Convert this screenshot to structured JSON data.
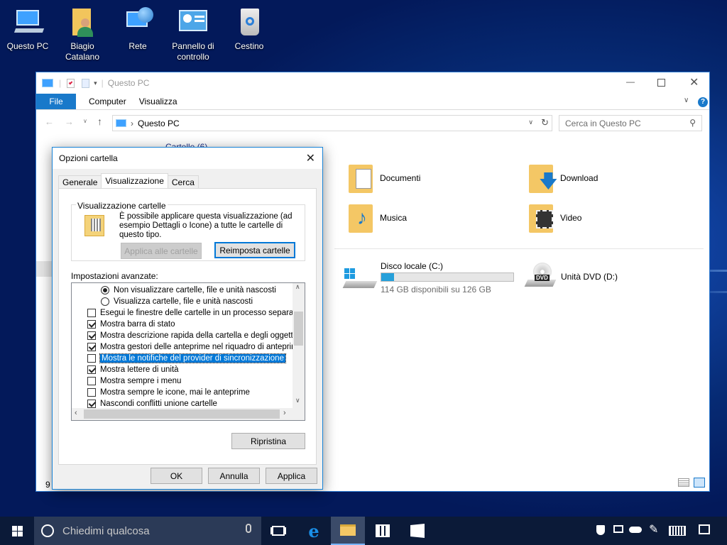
{
  "desktop": {
    "icons": [
      {
        "label": "Questo PC"
      },
      {
        "label": "Biagio Catalano"
      },
      {
        "label": "Rete"
      },
      {
        "label": "Pannello di controllo"
      },
      {
        "label": "Cestino"
      }
    ]
  },
  "explorer": {
    "title": "Questo PC",
    "ribbon_tabs": [
      "File",
      "Computer",
      "Visualizza"
    ],
    "address": "Questo PC",
    "search_placeholder": "Cerca in Questo PC",
    "section_partial": "Cartelle (6)",
    "folders": [
      "Documenti",
      "Download",
      "Musica",
      "Video"
    ],
    "drives": [
      {
        "name": "Disco locale (C:)",
        "free_text": "114 GB disponibili su 126 GB",
        "used_fraction": 0.095
      },
      {
        "name": "Unità DVD (D:)",
        "badge": "DVD"
      }
    ],
    "status_partial": "9"
  },
  "dialog": {
    "title": "Opzioni cartella",
    "tabs": [
      "Generale",
      "Visualizzazione",
      "Cerca"
    ],
    "group_label": "Visualizzazione cartelle",
    "group_text": "È possibile applicare questa visualizzazione (ad esempio Dettagli o Icone) a tutte le cartelle di questo tipo.",
    "apply_all_label": "Applica alle cartelle",
    "reset_folders_label": "Reimposta cartelle",
    "advanced_label": "Impostazioni avanzate:",
    "settings": [
      {
        "type": "radio",
        "checked": true,
        "label": "Non visualizzare cartelle, file e unità nascosti"
      },
      {
        "type": "radio",
        "checked": false,
        "label": "Visualizza cartelle, file e unità nascosti"
      },
      {
        "type": "check",
        "checked": false,
        "label": "Esegui le finestre delle cartelle in un processo separato"
      },
      {
        "type": "check",
        "checked": true,
        "label": "Mostra barra di stato"
      },
      {
        "type": "check",
        "checked": true,
        "label": "Mostra descrizione rapida della cartella e degli oggetti del"
      },
      {
        "type": "check",
        "checked": true,
        "label": "Mostra gestori delle anteprime nel riquadro di anteprima"
      },
      {
        "type": "check",
        "checked": false,
        "label": "Mostra le notifiche del provider di sincronizzazione",
        "selected": true
      },
      {
        "type": "check",
        "checked": true,
        "label": "Mostra lettere di unità"
      },
      {
        "type": "check",
        "checked": false,
        "label": "Mostra sempre i menu"
      },
      {
        "type": "check",
        "checked": false,
        "label": "Mostra sempre le icone, mai le anteprime"
      },
      {
        "type": "check",
        "checked": true,
        "label": "Nascondi conflitti unione cartelle"
      }
    ],
    "restore_label": "Ripristina",
    "ok_label": "OK",
    "cancel_label": "Annulla",
    "apply_label": "Applica"
  },
  "taskbar": {
    "search_placeholder": "Chiedimi qualcosa"
  }
}
